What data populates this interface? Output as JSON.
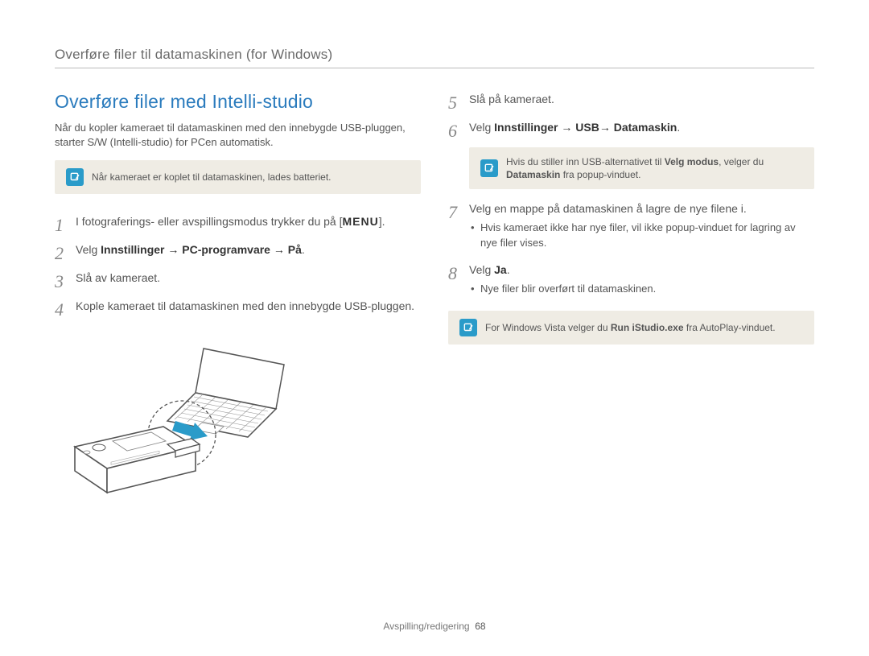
{
  "header": {
    "path": "Overføre filer til datamaskinen (for Windows)"
  },
  "left": {
    "title": "Overføre filer med Intelli-studio",
    "intro": "Når du kopler kameraet til datamaskinen med den innebygde USB-pluggen, starter S/W (Intelli-studio) for PCen automatisk.",
    "note": "Når kameraet er koplet til datamaskinen, lades batteriet.",
    "steps": {
      "s1_pre": "I fotograferings- eller avspillingsmodus trykker du på [",
      "s1_menu": "MENU",
      "s1_post": "].",
      "s2_pre": "Velg ",
      "s2_bold": "Innstillinger → PC-programvare → På",
      "s2_post": ".",
      "s3": "Slå av kameraet.",
      "s4": "Kople kameraet til datamaskinen med den innebygde USB-pluggen."
    }
  },
  "right": {
    "steps": {
      "s5": "Slå på kameraet.",
      "s6_pre": "Velg ",
      "s6_bold": "Innstillinger → USB→ Datamaskin",
      "s6_post": ".",
      "s7": "Velg en mappe på datamaskinen å lagre de nye filene i.",
      "s7_sub": "Hvis kameraet ikke har nye filer, vil ikke popup-vinduet for lagring av nye filer vises.",
      "s8_pre": "Velg ",
      "s8_bold": "Ja",
      "s8_post": ".",
      "s8_sub": "Nye filer blir overført til datamaskinen."
    },
    "note1_pre": "Hvis du stiller inn USB-alternativet til ",
    "note1_b1": "Velg modus",
    "note1_mid": ", velger du ",
    "note1_b2": "Datamaskin",
    "note1_post": " fra popup-vinduet.",
    "note2_pre": "For Windows Vista velger du ",
    "note2_b": "Run iStudio.exe",
    "note2_post": " fra AutoPlay-vinduet."
  },
  "footer": {
    "section": "Avspilling/redigering",
    "page": "68"
  }
}
